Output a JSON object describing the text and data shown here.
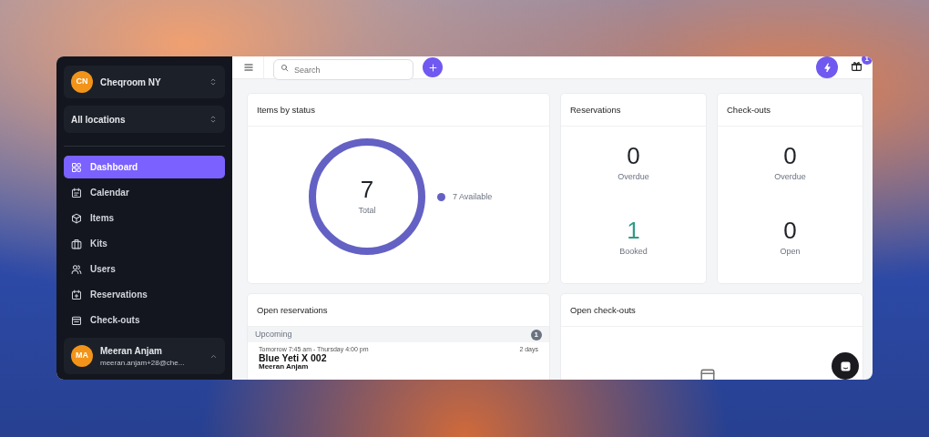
{
  "sidebar": {
    "workspace": {
      "initials": "CN",
      "name": "Cheqroom NY"
    },
    "location": "All locations",
    "items": [
      {
        "label": "Dashboard",
        "selected": true
      },
      {
        "label": "Calendar",
        "selected": false
      },
      {
        "label": "Items",
        "selected": false
      },
      {
        "label": "Kits",
        "selected": false
      },
      {
        "label": "Users",
        "selected": false
      },
      {
        "label": "Reservations",
        "selected": false
      },
      {
        "label": "Check-outs",
        "selected": false
      }
    ],
    "user": {
      "initials": "MA",
      "name": "Meeran Anjam",
      "email": "meeran.anjam+28@che..."
    }
  },
  "topbar": {
    "search": {
      "placeholder": "Search"
    },
    "notification_count": "1"
  },
  "items_by_status": {
    "title": "Items by status",
    "total": "7",
    "total_label": "Total",
    "legend": [
      {
        "label": "7 Available",
        "color": "#6461c4"
      }
    ]
  },
  "reservations": {
    "title": "Reservations",
    "stats": [
      {
        "value": "0",
        "label": "Overdue",
        "highlighted": false
      },
      {
        "value": "1",
        "label": "Booked",
        "highlighted": true
      }
    ]
  },
  "checkouts": {
    "title": "Check-outs",
    "stats": [
      {
        "value": "0",
        "label": "Overdue",
        "highlighted": false
      },
      {
        "value": "0",
        "label": "Open",
        "highlighted": false
      }
    ]
  },
  "open_reservations": {
    "title": "Open reservations",
    "group": {
      "label": "Upcoming",
      "count": "1"
    },
    "entries": [
      {
        "when": "Tomorrow 7:45 am - Thursday 4:00 pm",
        "duration": "2 days",
        "name": "Blue Yeti X 002",
        "person": "Meeran Anjam"
      }
    ]
  },
  "open_checkouts": {
    "title": "Open check-outs"
  }
}
